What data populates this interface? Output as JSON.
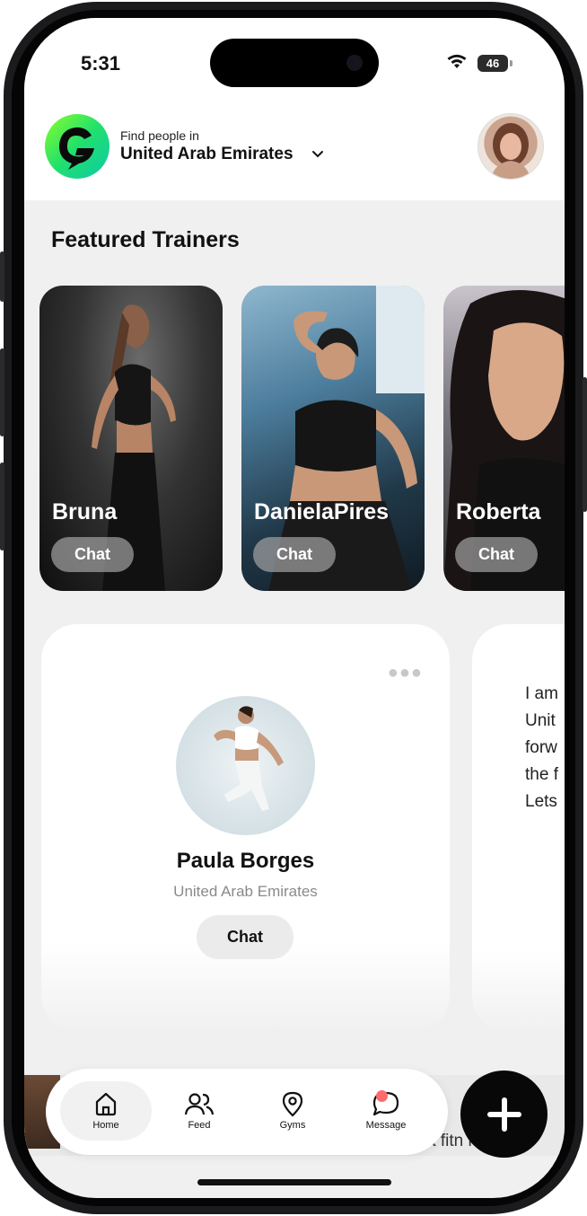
{
  "status_bar": {
    "time": "5:31",
    "battery": "46",
    "icons": [
      "wifi-icon",
      "battery-icon"
    ]
  },
  "header": {
    "logo_icon": "g-logo-icon",
    "find_label": "Find people in",
    "country": "United Arab Emirates",
    "dropdown_icon": "chevron-down-icon",
    "avatar": "user-avatar"
  },
  "featured": {
    "title": "Featured Trainers",
    "cards": [
      {
        "name": "Bruna",
        "chat_label": "Chat"
      },
      {
        "name": "DanielaPires",
        "chat_label": "Chat"
      },
      {
        "name": "Roberta",
        "chat_label": "Chat"
      }
    ]
  },
  "profiles": [
    {
      "name": "Paula Borges",
      "location": "United Arab Emirates",
      "chat_label": "Chat",
      "menu_icon": "more-dots-icon"
    },
    {
      "bio_lines": [
        "I am",
        "Unit",
        "forw",
        "the f",
        "Lets"
      ]
    }
  ],
  "strip_text": "a fitn   nth",
  "nav": {
    "items": [
      {
        "label": "Home",
        "icon": "home-icon",
        "active": true
      },
      {
        "label": "Feed",
        "icon": "people-icon",
        "active": false
      },
      {
        "label": "Gyms",
        "icon": "location-pin-icon",
        "active": false
      },
      {
        "label": "Message",
        "icon": "chat-bubble-icon",
        "active": false,
        "badge": true
      }
    ],
    "fab_icon": "plus-icon"
  },
  "colors": {
    "accent_green": "#20e06d",
    "badge": "#ff6b6b",
    "fab": "#080808"
  }
}
